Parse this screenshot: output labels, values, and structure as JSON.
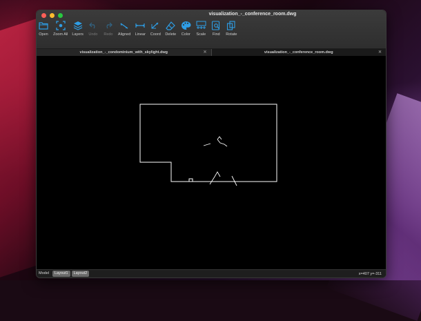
{
  "window": {
    "title": "visualization_-_conference_room.dwg"
  },
  "toolbar": {
    "items": [
      {
        "id": "open",
        "label": "Open",
        "icon": "folder-icon",
        "enabled": true
      },
      {
        "id": "zoom_all",
        "label": "Zoom All",
        "icon": "zoom-extents-icon",
        "enabled": true
      },
      {
        "id": "layers",
        "label": "Layers",
        "icon": "layers-icon",
        "enabled": true
      },
      {
        "id": "undo",
        "label": "Undo",
        "icon": "undo-icon",
        "enabled": false
      },
      {
        "id": "redo",
        "label": "Redo",
        "icon": "redo-icon",
        "enabled": false
      },
      {
        "id": "aligned",
        "label": "Aligned",
        "icon": "aligned-dimension-icon",
        "enabled": true
      },
      {
        "id": "linear",
        "label": "Linear",
        "icon": "linear-dimension-icon",
        "enabled": true
      },
      {
        "id": "coord",
        "label": "Coord",
        "icon": "coordinate-icon",
        "enabled": true
      },
      {
        "id": "delete",
        "label": "Delete",
        "icon": "eraser-icon",
        "enabled": true
      },
      {
        "id": "color",
        "label": "Color",
        "icon": "palette-icon",
        "enabled": true
      },
      {
        "id": "scale",
        "label": "Scale",
        "icon": "scale-icon",
        "enabled": true
      },
      {
        "id": "find",
        "label": "Find",
        "icon": "find-icon",
        "enabled": true
      },
      {
        "id": "rotate",
        "label": "Rotate",
        "icon": "rotate-icon",
        "enabled": true
      }
    ],
    "accent_color": "#2e9ee6"
  },
  "tabs": [
    {
      "label": "visualization_-_condominium_with_skylight.dwg",
      "active": false,
      "close": "✕"
    },
    {
      "label": "visualization_-_conference_room.dwg",
      "active": true,
      "close": "✕"
    }
  ],
  "status": {
    "layout_tabs": [
      "Model",
      "Layout1",
      "Layout2"
    ],
    "coordinates": "x=407 y=-311"
  }
}
